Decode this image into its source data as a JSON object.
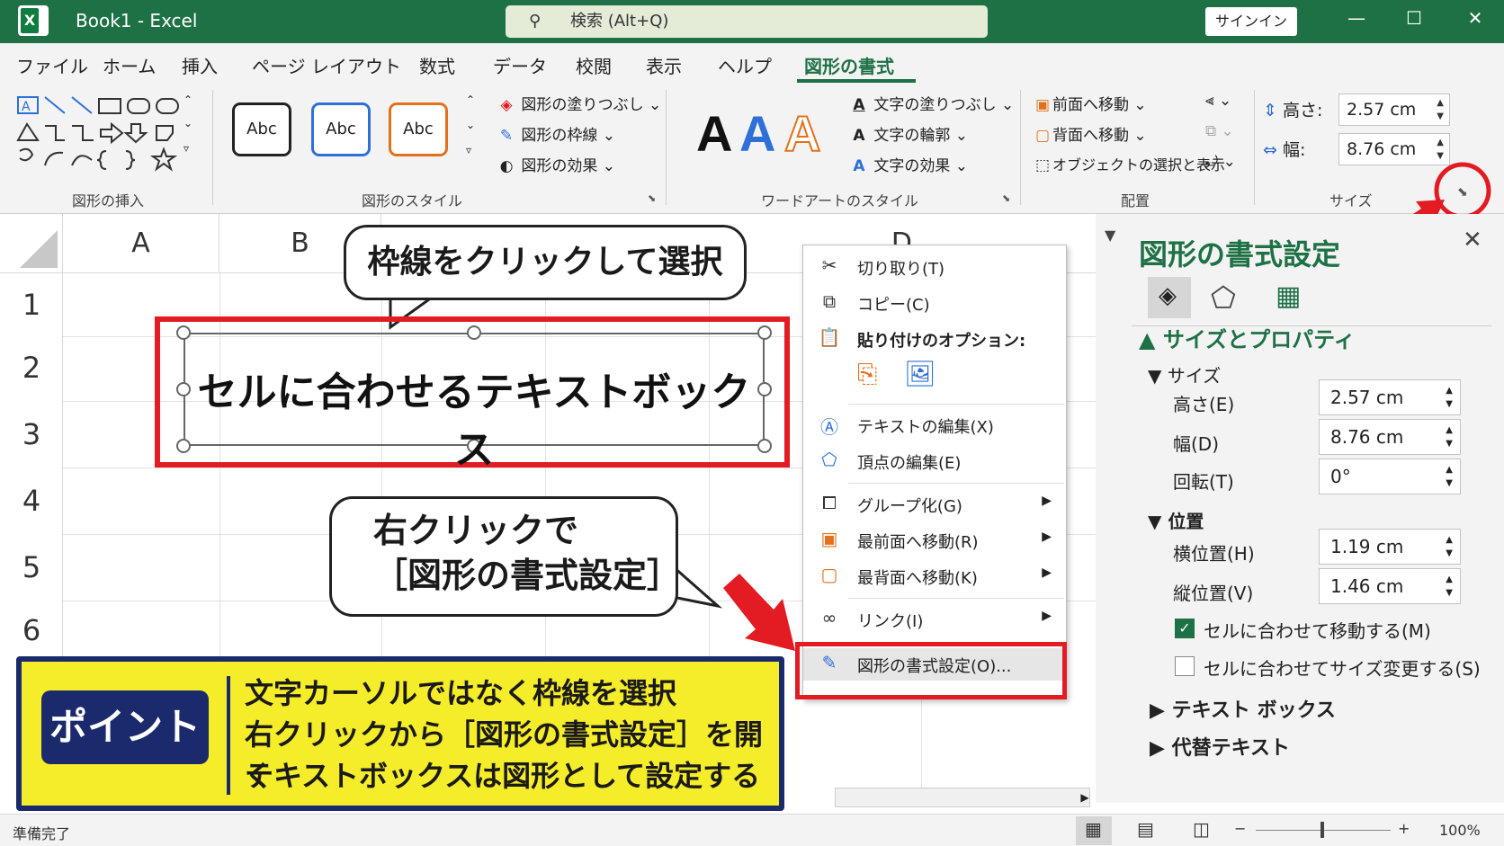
{
  "titlebar": {
    "app_icon": "X",
    "title": "Book1  -  Excel",
    "search_placeholder": "検索 (Alt+Q)",
    "signin": "サインイン",
    "minimize": "—",
    "maximize": "☐",
    "close": "✕"
  },
  "menu": {
    "tabs": [
      "ファイル",
      "ホーム",
      "挿入",
      "ページ レイアウト",
      "数式",
      "データ",
      "校閲",
      "表示",
      "ヘルプ",
      "図形の書式"
    ],
    "active": "図形の書式"
  },
  "ribbon": {
    "insert_shapes": {
      "label": "図形の挿入"
    },
    "shape_styles": {
      "label": "図形のスタイル",
      "swatch": "Abc",
      "swatch_colors": [
        "#222222",
        "#2f6fd8",
        "#e3711c"
      ],
      "fill": "図形の塗りつぶし",
      "outline": "図形の枠線",
      "effects": "図形の効果"
    },
    "wordart": {
      "label": "ワードアートのスタイル",
      "letter": "A",
      "text_fill": "文字の塗りつぶし",
      "text_outline": "文字の輪郭",
      "text_effects": "文字の効果"
    },
    "arrange": {
      "label": "配置",
      "bring_forward": "前面へ移動",
      "send_backward": "背面へ移動",
      "selection_pane": "オブジェクトの選択と表示"
    },
    "size": {
      "label": "サイズ",
      "height_label": "高さ:",
      "height_value": "2.57 cm",
      "width_label": "幅:",
      "width_value": "8.76 cm"
    }
  },
  "sheet": {
    "columns": [
      "A",
      "B",
      "D"
    ],
    "rows": [
      "1",
      "2",
      "3",
      "4",
      "5",
      "6"
    ],
    "textbox_text": "セルに合わせるテキストボックス"
  },
  "callouts": {
    "top": "枠線をクリックして選択",
    "middle_line1": "右クリックで",
    "middle_line2": "［図形の書式設定］"
  },
  "context_menu": {
    "items": [
      {
        "icon": "scissors-icon",
        "label": "切り取り(T)"
      },
      {
        "icon": "copy-icon",
        "label": "コピー(C)"
      },
      {
        "icon": "paste-icon",
        "label": "貼り付けのオプション:"
      },
      {
        "icon": "edit-text-icon",
        "label": "テキストの編集(X)"
      },
      {
        "icon": "edit-points-icon",
        "label": "頂点の編集(E)"
      },
      {
        "icon": "group-icon",
        "label": "グループ化(G)"
      },
      {
        "icon": "bring-front-icon",
        "label": "最前面へ移動(R)"
      },
      {
        "icon": "send-back-icon",
        "label": "最背面へ移動(K)"
      },
      {
        "icon": "link-icon",
        "label": "リンク(I)"
      },
      {
        "icon": "format-shape-icon",
        "label": "図形の書式設定(O)..."
      }
    ]
  },
  "format_pane": {
    "title": "図形の書式設定",
    "section": "サイズとプロパティ",
    "size_heading": "サイズ",
    "height_label": "高さ(E)",
    "height_value": "2.57 cm",
    "width_label": "幅(D)",
    "width_value": "8.76 cm",
    "rotation_label": "回転(T)",
    "rotation_value": "0°",
    "position_heading": "位置",
    "hpos_label": "横位置(H)",
    "hpos_value": "1.19 cm",
    "vpos_label": "縦位置(V)",
    "vpos_value": "1.46 cm",
    "move_with_cells": "セルに合わせて移動する(M)",
    "move_with_cells_checked": true,
    "size_with_cells": "セルに合わせてサイズ変更する(S)",
    "size_with_cells_checked": false,
    "textbox_section": "テキスト ボックス",
    "alt_text_section": "代替テキスト"
  },
  "point": {
    "badge": "ポイント",
    "lines": [
      "文字カーソルではなく枠線を選択",
      "右クリックから［図形の書式設定］を開く",
      "テキストボックスは図形として設定する"
    ]
  },
  "status": {
    "ready": "準備完了",
    "zoom": "100%"
  }
}
